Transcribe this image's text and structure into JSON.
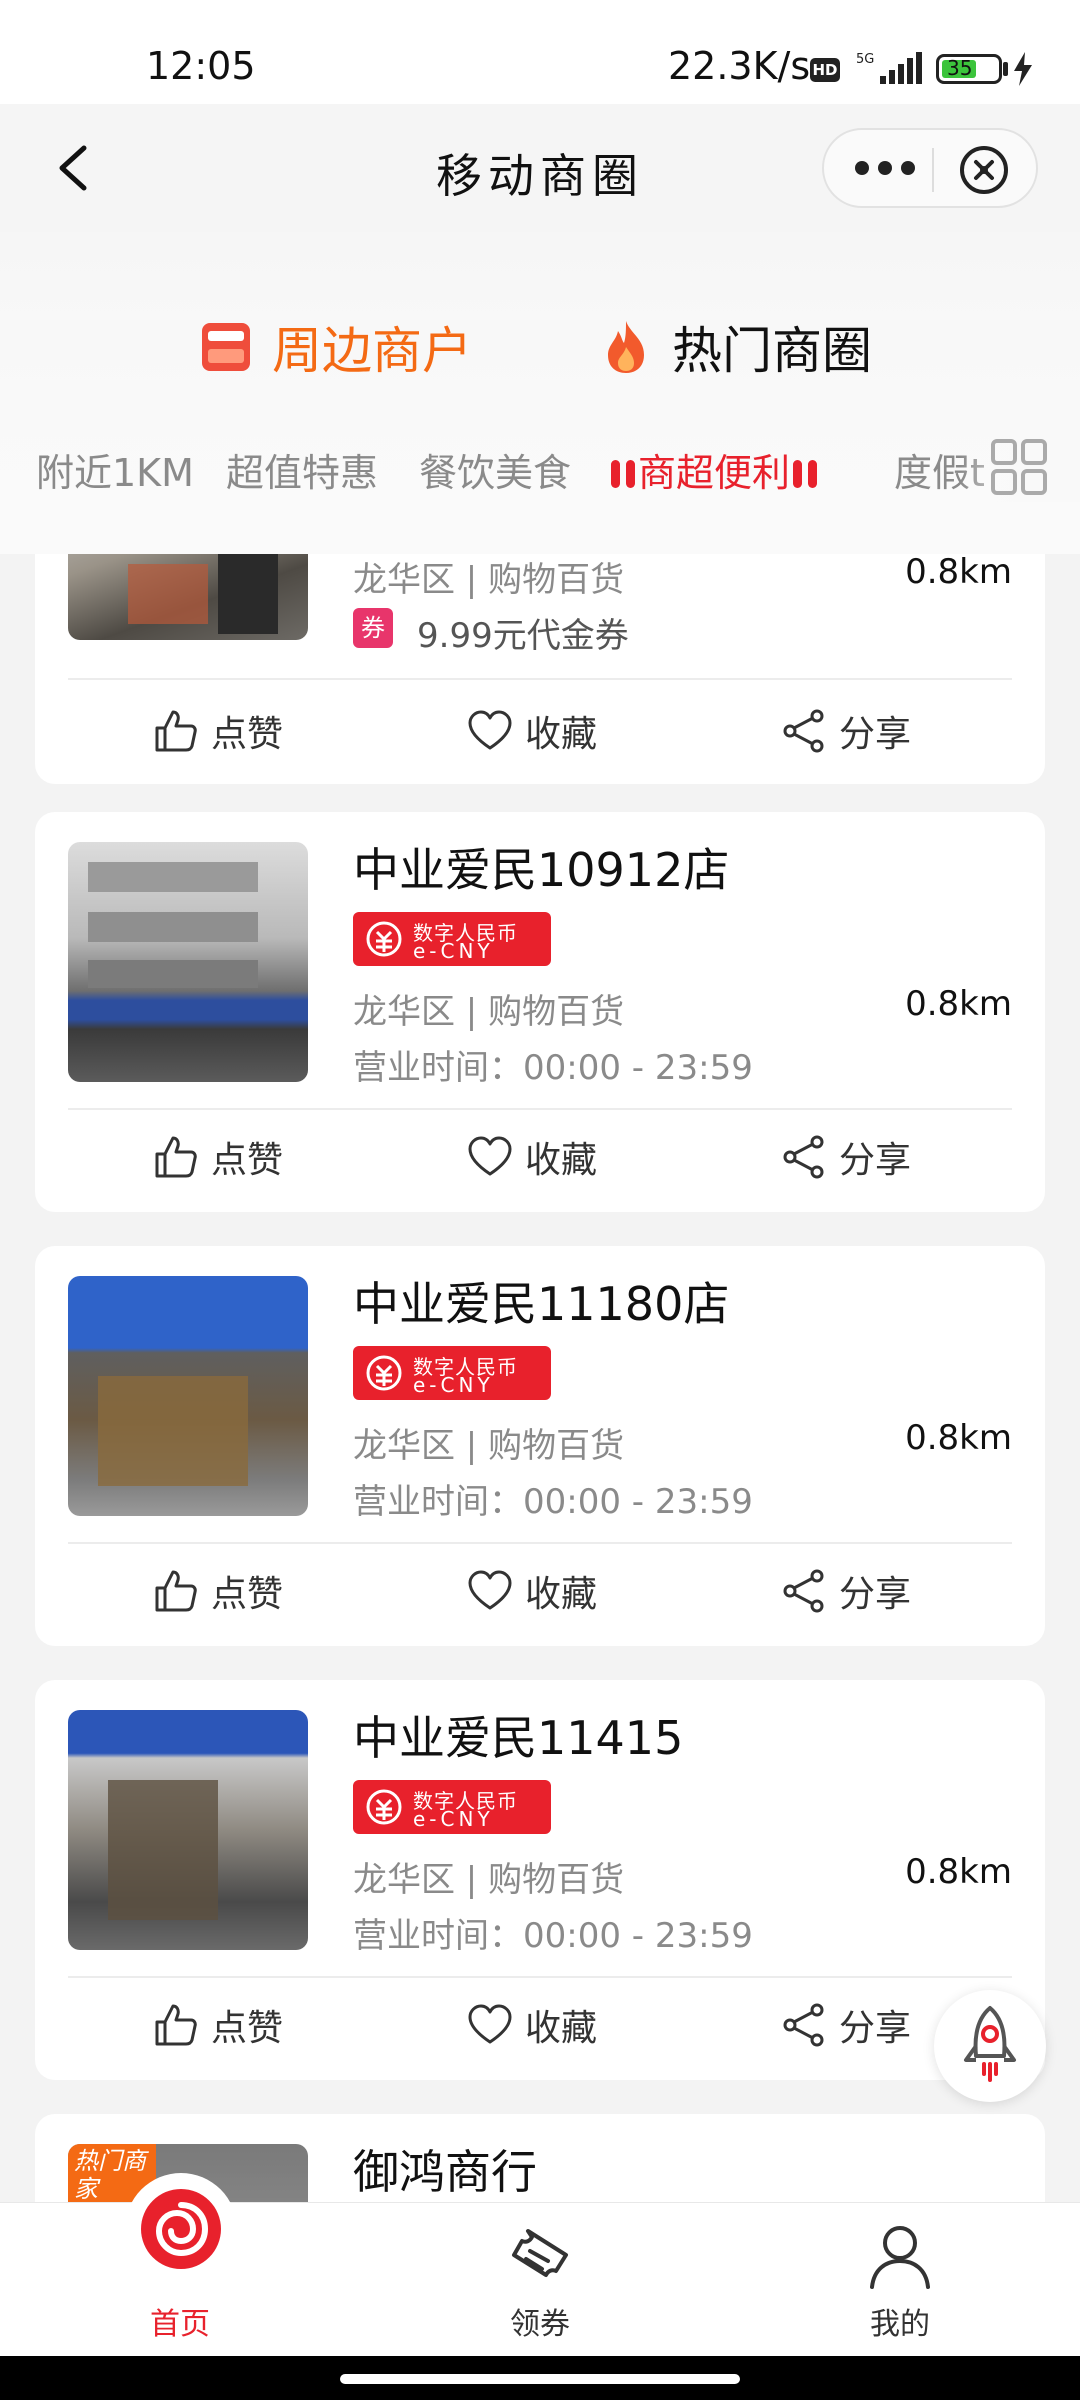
{
  "status_bar": {
    "time": "12:05",
    "net_speed": "22.3K/s",
    "hd": "HD",
    "network": "5G",
    "battery": "35"
  },
  "title_bar": {
    "title": "移动商圈"
  },
  "top_tabs": [
    {
      "label": "周边商户",
      "active": true,
      "icon": "shop-icon"
    },
    {
      "label": "热门商圈",
      "active": false,
      "icon": "fire-icon"
    }
  ],
  "categories": [
    {
      "label": "附近1KM",
      "active": false
    },
    {
      "label": "超值特惠",
      "active": false
    },
    {
      "label": "餐饮美食",
      "active": false
    },
    {
      "label": "商超便利",
      "active": true
    },
    {
      "label": "度假t",
      "active": false
    }
  ],
  "actions": {
    "like": "点赞",
    "favorite": "收藏",
    "share": "分享"
  },
  "ecny": {
    "line1": "数字人民币",
    "line2": "e-CNY"
  },
  "stores": [
    {
      "name": "",
      "district": "龙华区 | 购物百货",
      "distance": "0.8km",
      "coupon_tag": "券",
      "coupon": "9.99元代金券",
      "hours": ""
    },
    {
      "name": "中业爱民10912店",
      "district": "龙华区 | 购物百货",
      "distance": "0.8km",
      "hours": "营业时间：00:00 - 23:59"
    },
    {
      "name": "中业爱民11180店",
      "district": "龙华区 | 购物百货",
      "distance": "0.8km",
      "hours": "营业时间：00:00 - 23:59"
    },
    {
      "name": "中业爱民11415",
      "district": "龙华区 | 购物百货",
      "distance": "0.8km",
      "hours": "营业时间：00:00 - 23:59"
    },
    {
      "name": "御鸿商行",
      "badge": "热门商家",
      "district": "",
      "distance": "",
      "hours": ""
    }
  ],
  "bottom_nav": [
    {
      "label": "首页",
      "active": true,
      "icon": "home-logo-icon"
    },
    {
      "label": "领券",
      "active": false,
      "icon": "ticket-icon"
    },
    {
      "label": "我的",
      "active": false,
      "icon": "user-icon"
    }
  ],
  "colors": {
    "accent_red": "#e8212c",
    "accent_orange": "#f46a14"
  }
}
